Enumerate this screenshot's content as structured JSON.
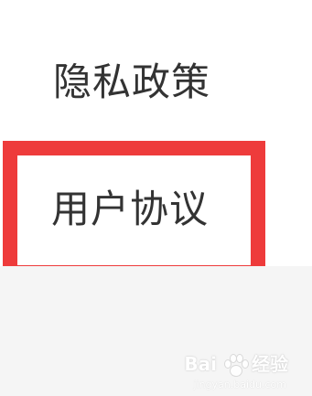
{
  "settings": {
    "items": [
      {
        "label": "隐私政策"
      },
      {
        "label": "用户协议"
      }
    ]
  },
  "watermark": {
    "brand": "Bai",
    "text": "经验",
    "url": "jingyan.baidu.com"
  },
  "colors": {
    "highlight": "#ee3b3b",
    "text": "#333333",
    "background": "#ffffff",
    "lower_background": "#f5f5f5"
  }
}
